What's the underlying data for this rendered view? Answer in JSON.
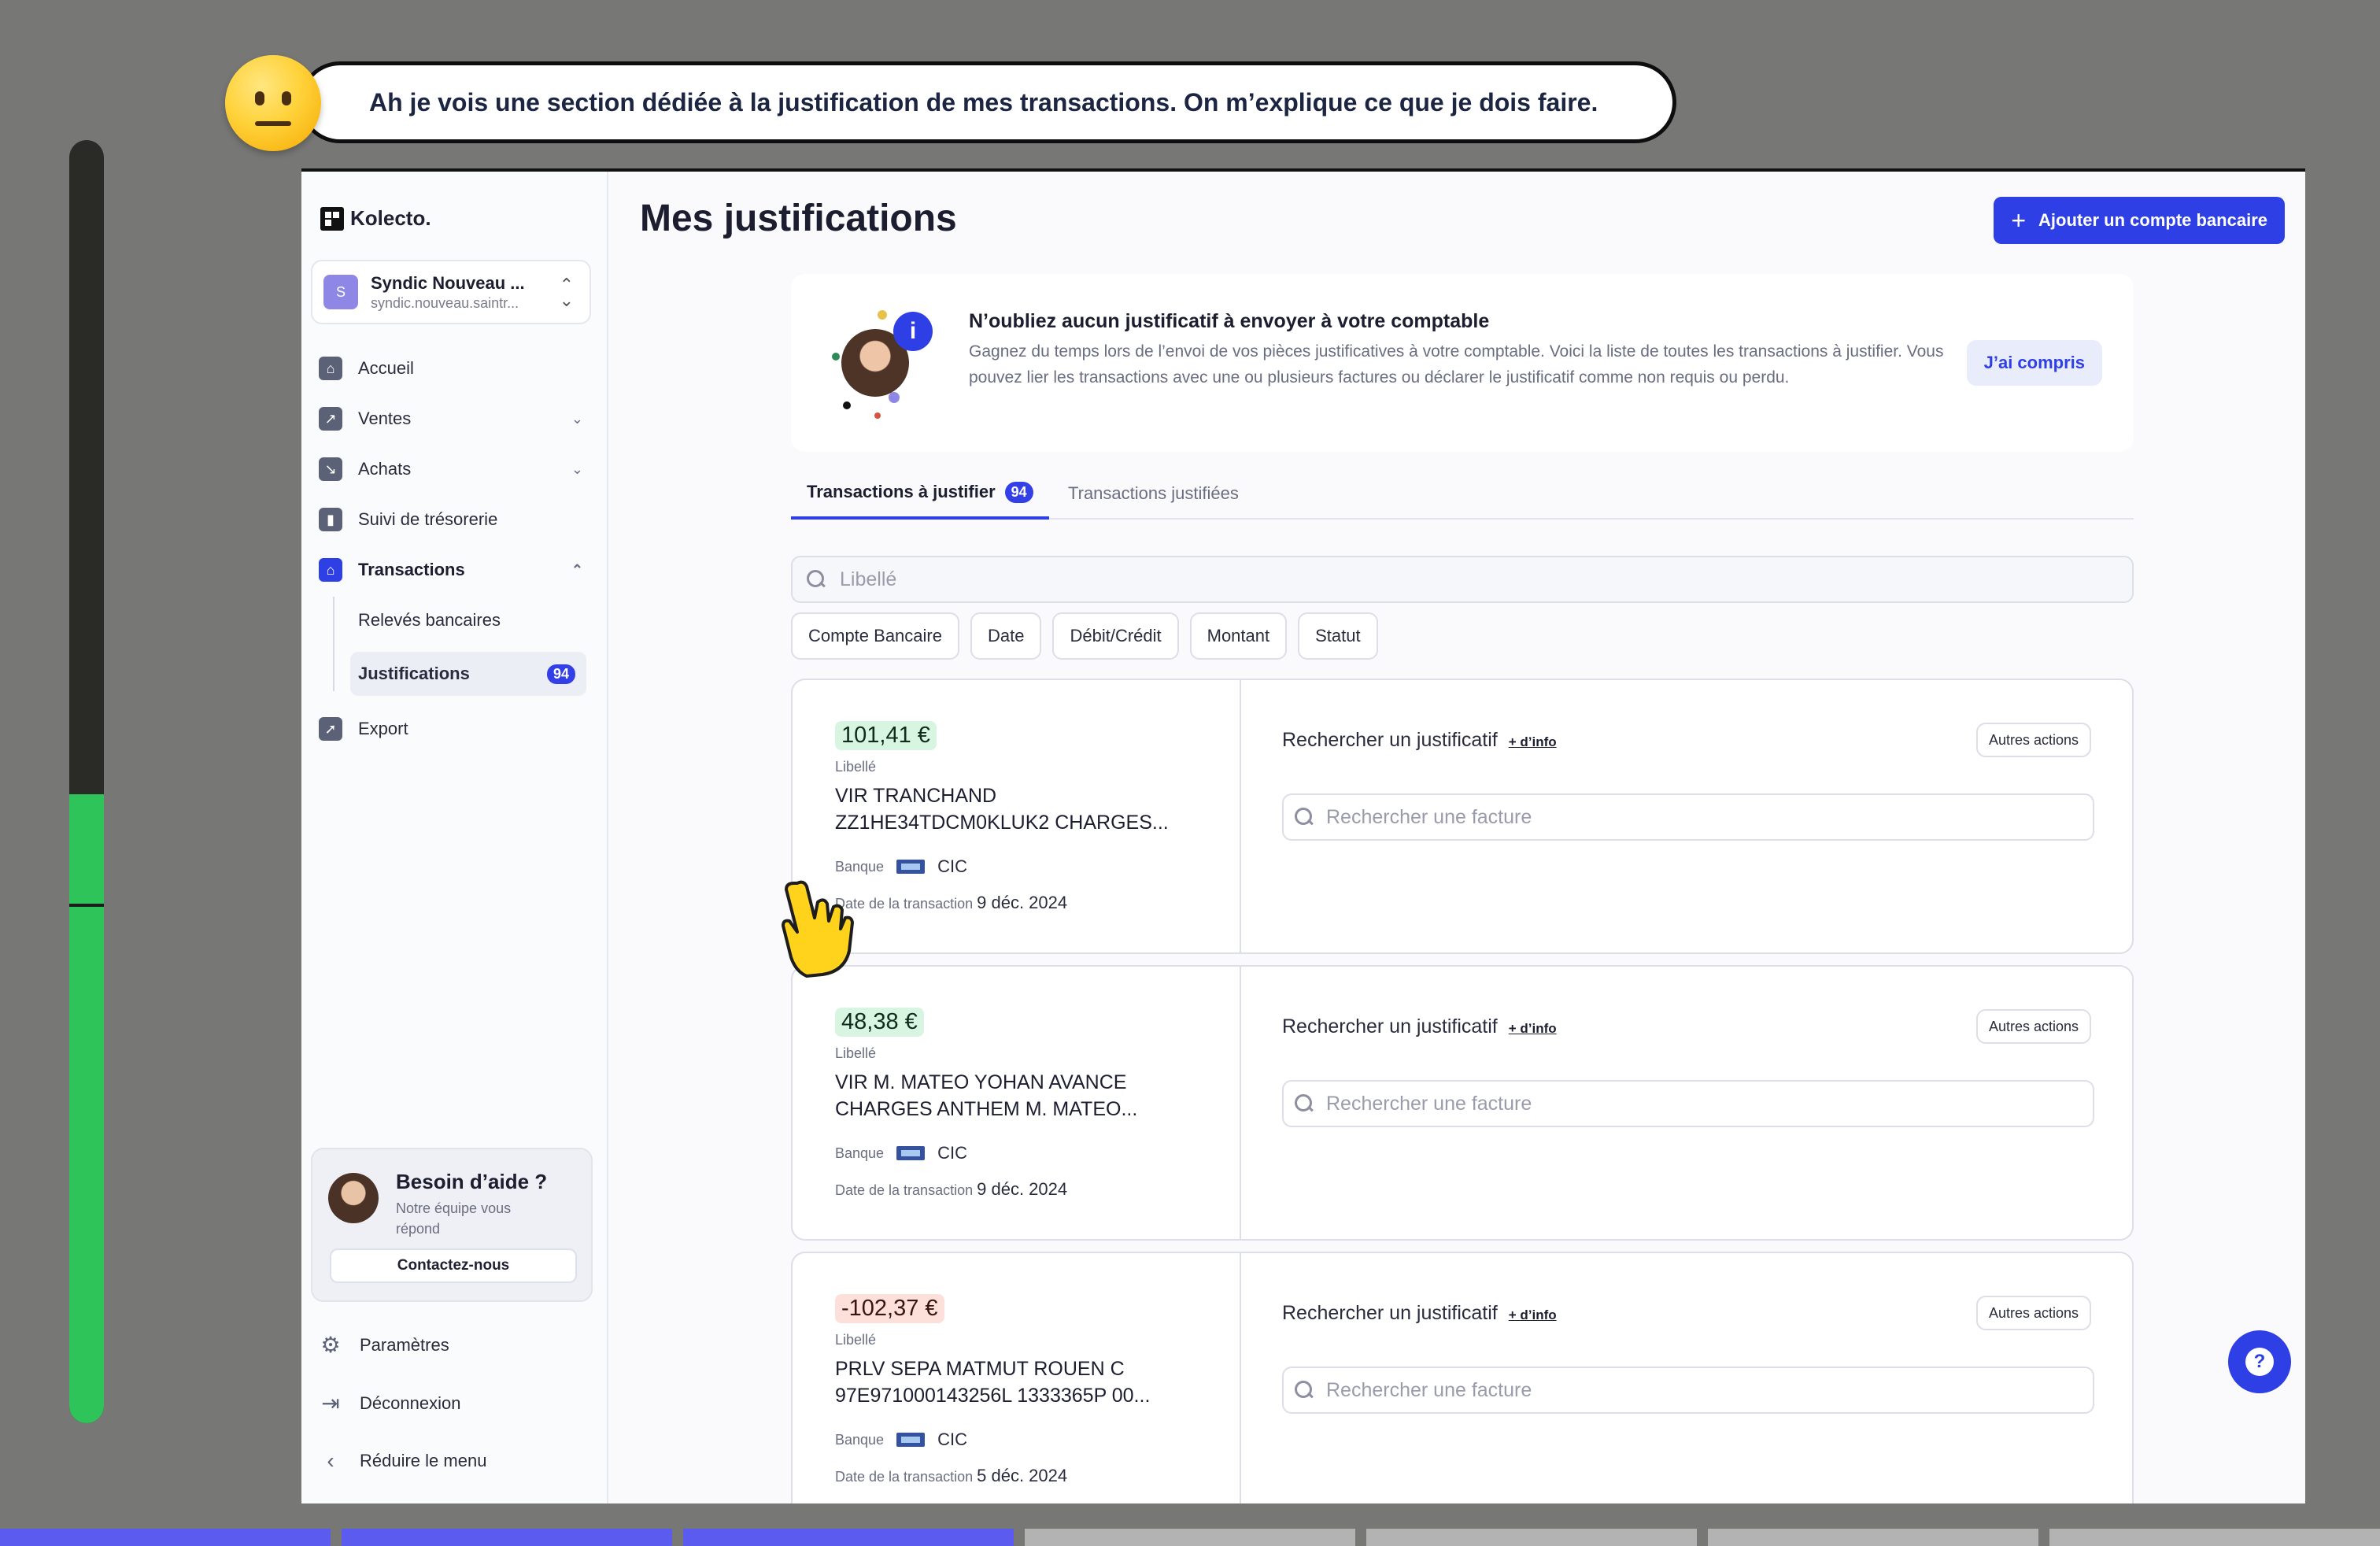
{
  "narration": {
    "text": "Ah je vois une section dédiée à la justification de mes transactions. On m’explique ce que je dois faire."
  },
  "progress": {
    "fraction": 0.49
  },
  "steps": {
    "total": 7,
    "completed": 3
  },
  "brand": {
    "name": "Kolecto.",
    "accent": "#2f3fe6"
  },
  "org": {
    "avatar_letter": "S",
    "name": "Syndic Nouveau ...",
    "email": "syndic.nouveau.saintr..."
  },
  "sidebar": {
    "items": [
      {
        "label": "Accueil"
      },
      {
        "label": "Ventes"
      },
      {
        "label": "Achats"
      },
      {
        "label": "Suivi de trésorerie"
      },
      {
        "label": "Transactions"
      }
    ],
    "sub_items": [
      {
        "label": "Relevés bancaires"
      },
      {
        "label": "Justifications",
        "badge": "94"
      }
    ],
    "export": "Export",
    "help": {
      "title": "Besoin d’aide ?",
      "subtitle": "Notre équipe vous répond",
      "button": "Contactez-nous"
    },
    "settings": "Paramètres",
    "logout": "Déconnexion",
    "collapse": "Réduire le menu"
  },
  "main": {
    "title": "Mes justifications",
    "add_button": "Ajouter un compte bancaire",
    "info": {
      "title": "N’oubliez aucun justificatif à envoyer à votre comptable",
      "text": "Gagnez du temps lors de l’envoi de vos pièces justificatives à votre comptable. Voici la liste de toutes les transactions à justifier. Vous pouvez lier les transactions avec une ou plusieurs factures ou déclarer le justificatif comme non requis ou perdu.",
      "button": "J’ai compris"
    },
    "tabs": [
      {
        "label": "Transactions à justifier",
        "count": "94"
      },
      {
        "label": "Transactions justifiées"
      }
    ],
    "search_placeholder": "Libellé",
    "filters": [
      "Compte Bancaire",
      "Date",
      "Débit/Crédit",
      "Montant",
      "Statut"
    ],
    "card_labels": {
      "label": "Libellé",
      "bank": "Banque",
      "date": "Date de la transaction",
      "search_title": "Rechercher un justificatif",
      "more_info": "+ d’info",
      "other_actions": "Autres actions",
      "invoice_placeholder": "Rechercher une facture"
    },
    "transactions": [
      {
        "amount": "101,41 €",
        "sign": "pos",
        "description": "VIR TRANCHAND ZZ1HE34TDCM0KLUK2 CHARGES...",
        "bank": "CIC",
        "date": "9 déc. 2024"
      },
      {
        "amount": "48,38 €",
        "sign": "pos",
        "description": "VIR M. MATEO YOHAN AVANCE CHARGES ANTHEM M. MATEO...",
        "bank": "CIC",
        "date": "9 déc. 2024"
      },
      {
        "amount": "-102,37 €",
        "sign": "neg",
        "description": "PRLV SEPA MATMUT ROUEN C 97E971000143256L 1333365P 00...",
        "bank": "CIC",
        "date": "5 déc. 2024"
      }
    ]
  }
}
